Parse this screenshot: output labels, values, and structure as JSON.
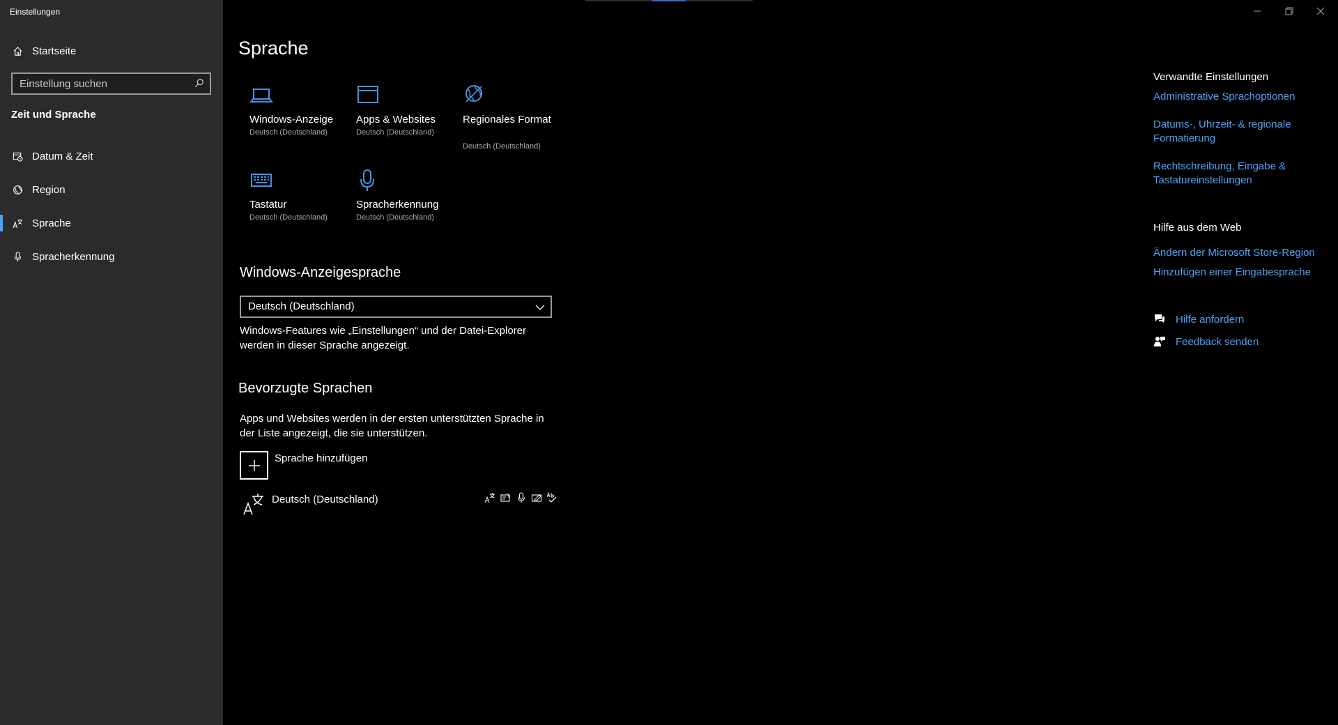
{
  "window": {
    "title": "Einstellungen"
  },
  "sidebar": {
    "home_label": "Startseite",
    "search_placeholder": "Einstellung suchen",
    "section_heading": "Zeit und Sprache",
    "items": [
      {
        "label": "Datum & Zeit",
        "icon": "calendar-clock-icon"
      },
      {
        "label": "Region",
        "icon": "globe-icon"
      },
      {
        "label": "Sprache",
        "icon": "language-icon",
        "active": true
      },
      {
        "label": "Spracherkennung",
        "icon": "microphone-icon"
      }
    ]
  },
  "main": {
    "title": "Sprache",
    "tiles": [
      {
        "title": "Windows-Anzeige",
        "subtitle": "Deutsch (Deutschland)",
        "icon": "laptop-icon"
      },
      {
        "title": "Apps & Websites",
        "subtitle": "Deutsch (Deutschland)",
        "icon": "window-icon"
      },
      {
        "title": "Regionales Format",
        "subtitle": "Deutsch (Deutschland)",
        "icon": "regional-format-icon"
      },
      {
        "title": "Tastatur",
        "subtitle": "Deutsch (Deutschland)",
        "icon": "keyboard-icon"
      },
      {
        "title": "Spracherkennung",
        "subtitle": "Deutsch (Deutschland)",
        "icon": "microphone-icon"
      }
    ],
    "display_language": {
      "heading": "Windows-Anzeigesprache",
      "selected": "Deutsch (Deutschland)",
      "description": "Windows-Features wie „Einstellungen“ und der Datei-Explorer werden in dieser Sprache angezeigt."
    },
    "preferred": {
      "heading": "Bevorzugte Sprachen",
      "description": "Apps und Websites werden in der ersten unterstützten Sprache in der Liste angezeigt, die sie unterstützen.",
      "add_label": "Sprache hinzufügen",
      "languages": [
        {
          "name": "Deutsch (Deutschland)"
        }
      ]
    }
  },
  "related": {
    "heading": "Verwandte Einstellungen",
    "links": [
      "Administrative Sprachoptionen",
      "Datums-, Uhrzeit- & regionale Formatierung",
      "Rechtschreibung, Eingabe & Tastatureinstellungen"
    ],
    "web_heading": "Hilfe aus dem Web",
    "web_links": [
      "Ändern der Microsoft Store-Region",
      "Hinzufügen einer Eingabesprache"
    ],
    "support": [
      {
        "label": "Hilfe anfordern",
        "icon": "help-chat-icon"
      },
      {
        "label": "Feedback senden",
        "icon": "feedback-icon"
      }
    ]
  },
  "colors": {
    "accent": "#4ea2f5",
    "sidebar_bg": "#2b2b2b",
    "main_bg": "#000000",
    "icon_blue": "#4a90e2"
  }
}
